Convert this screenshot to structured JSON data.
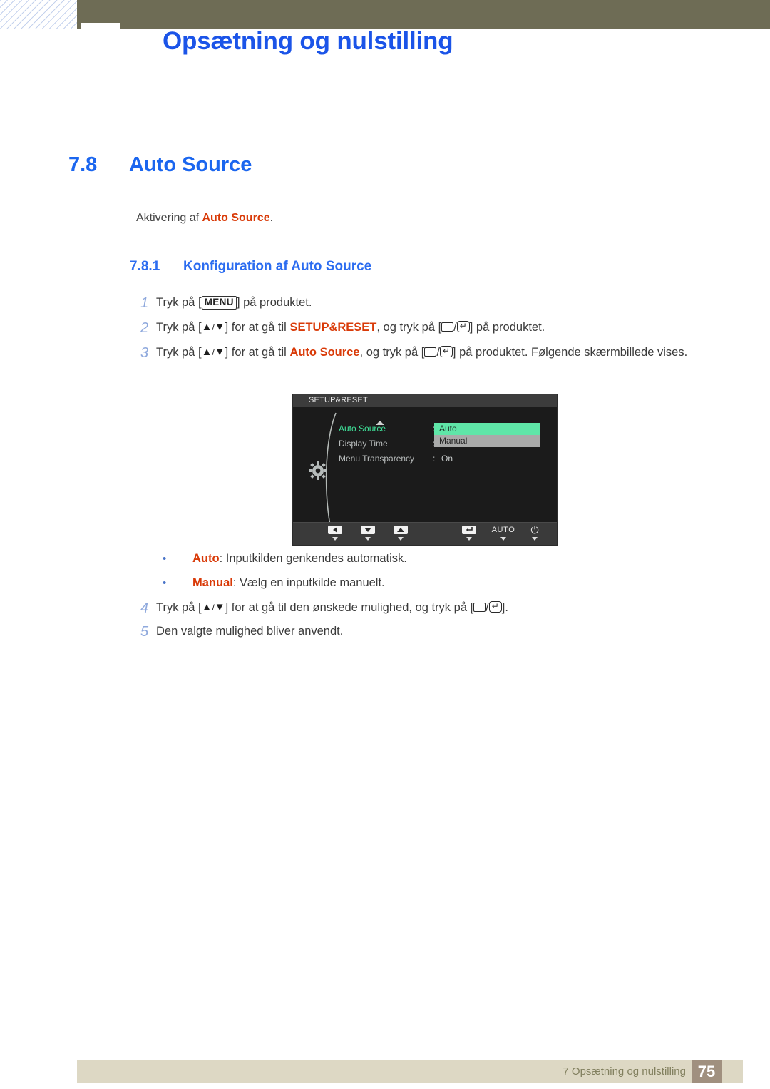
{
  "header": {
    "title": "Opsætning og nulstilling"
  },
  "section": {
    "number": "7.8",
    "title": "Auto Source",
    "intro_prefix": "Aktivering af ",
    "intro_keyword": "Auto Source",
    "intro_suffix": "."
  },
  "subsection": {
    "number": "7.8.1",
    "title": "Konfiguration af Auto Source"
  },
  "steps": [
    {
      "num": "1",
      "parts": [
        {
          "t": "Tryk på [",
          "k": false
        },
        {
          "t": "MENU",
          "k": "menu"
        },
        {
          "t": "] på produktet.",
          "k": false
        }
      ]
    },
    {
      "num": "2",
      "parts": [
        {
          "t": "Tryk på [",
          "k": false
        },
        {
          "t": "▲/▼",
          "k": "updown"
        },
        {
          "t": "] for at gå til ",
          "k": false
        },
        {
          "t": "SETUP&RESET",
          "k": "kw"
        },
        {
          "t": ", og tryk på [",
          "k": false
        },
        {
          "t": "rect",
          "k": "rect"
        },
        {
          "t": "/",
          "k": false
        },
        {
          "t": "enter",
          "k": "enter"
        },
        {
          "t": "] på produktet.",
          "k": false
        }
      ]
    },
    {
      "num": "3",
      "parts": [
        {
          "t": "Tryk på [",
          "k": false
        },
        {
          "t": "▲/▼",
          "k": "updown"
        },
        {
          "t": "] for at gå til ",
          "k": false
        },
        {
          "t": "Auto Source",
          "k": "kw"
        },
        {
          "t": ", og tryk på [",
          "k": false
        },
        {
          "t": "rect",
          "k": "rect"
        },
        {
          "t": "/",
          "k": false
        },
        {
          "t": "enter",
          "k": "enter"
        },
        {
          "t": "] på produktet. Følgende skærmbillede vises.",
          "k": false
        }
      ]
    },
    {
      "num": "4",
      "parts": [
        {
          "t": "Tryk på [",
          "k": false
        },
        {
          "t": "▲/▼",
          "k": "updown"
        },
        {
          "t": "] for at gå til den ønskede mulighed, og tryk på [",
          "k": false
        },
        {
          "t": "rect",
          "k": "rect"
        },
        {
          "t": "/",
          "k": false
        },
        {
          "t": "enter",
          "k": "enter"
        },
        {
          "t": "].",
          "k": false
        }
      ]
    },
    {
      "num": "5",
      "parts": [
        {
          "t": "Den valgte mulighed bliver anvendt.",
          "k": false
        }
      ]
    }
  ],
  "osd": {
    "title": "SETUP&RESET",
    "rows": [
      {
        "label": "Auto Source",
        "selected": true,
        "colon": ":",
        "value": ""
      },
      {
        "label": "Display Time",
        "selected": false,
        "colon": ":",
        "value": ""
      },
      {
        "label": "Menu Transparency",
        "selected": false,
        "colon": ":",
        "value": "On"
      }
    ],
    "dropdown": {
      "options": [
        {
          "label": "Auto",
          "state": "active"
        },
        {
          "label": "Manual",
          "state": "inactive"
        }
      ]
    },
    "buttons": [
      {
        "name": "left",
        "label": ""
      },
      {
        "name": "down",
        "label": ""
      },
      {
        "name": "up",
        "label": ""
      },
      {
        "name": "enter",
        "label": ""
      },
      {
        "name": "auto",
        "label": "AUTO"
      },
      {
        "name": "power",
        "label": "⏻"
      }
    ],
    "colors": {
      "highlight_green": "#5fe6a8",
      "option_gray": "#a9aaa9",
      "selected_text_green": "#3fe39a",
      "panel_bg": "#1b1b1b",
      "titlebar_bg": "#3c3c3c"
    }
  },
  "bullets": [
    {
      "dot": "•",
      "term": "Auto",
      "desc": ": Inputkilden genkendes automatisk."
    },
    {
      "dot": "•",
      "term": "Manual",
      "desc": ": Vælg en inputkilde manuelt."
    }
  ],
  "footer": {
    "chapter": "7 Opsætning og nulstilling",
    "page": "75"
  }
}
